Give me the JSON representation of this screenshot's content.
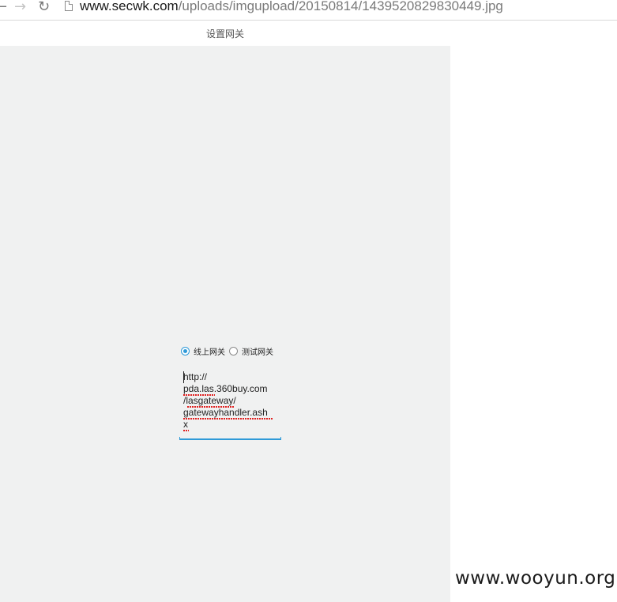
{
  "browser": {
    "url_host": "www.secwk.com",
    "url_path": "/uploads/imgupload/20150814/1439520829830449.jpg"
  },
  "app": {
    "title": "设置网关",
    "gateway_options": [
      {
        "label": "线上网关",
        "selected": true
      },
      {
        "label": "测试网关",
        "selected": false
      }
    ],
    "gateway_url": {
      "lines": [
        "http://",
        "pda.las.360buy.com",
        "/lasgateway/",
        "gatewayhandler.ash",
        "x"
      ],
      "value": "http://pda.las.360buy.com/lasgateway/gatewayhandler.ashx"
    }
  },
  "watermark": "www.wooyun.org",
  "colors": {
    "accent": "#2f9ad8",
    "app_background": "#f0f1f1",
    "spellcheck": "#e02020"
  },
  "icons": {
    "back": "arrow-left-icon",
    "forward": "arrow-right-icon",
    "reload": "reload-icon",
    "page": "page-icon"
  }
}
